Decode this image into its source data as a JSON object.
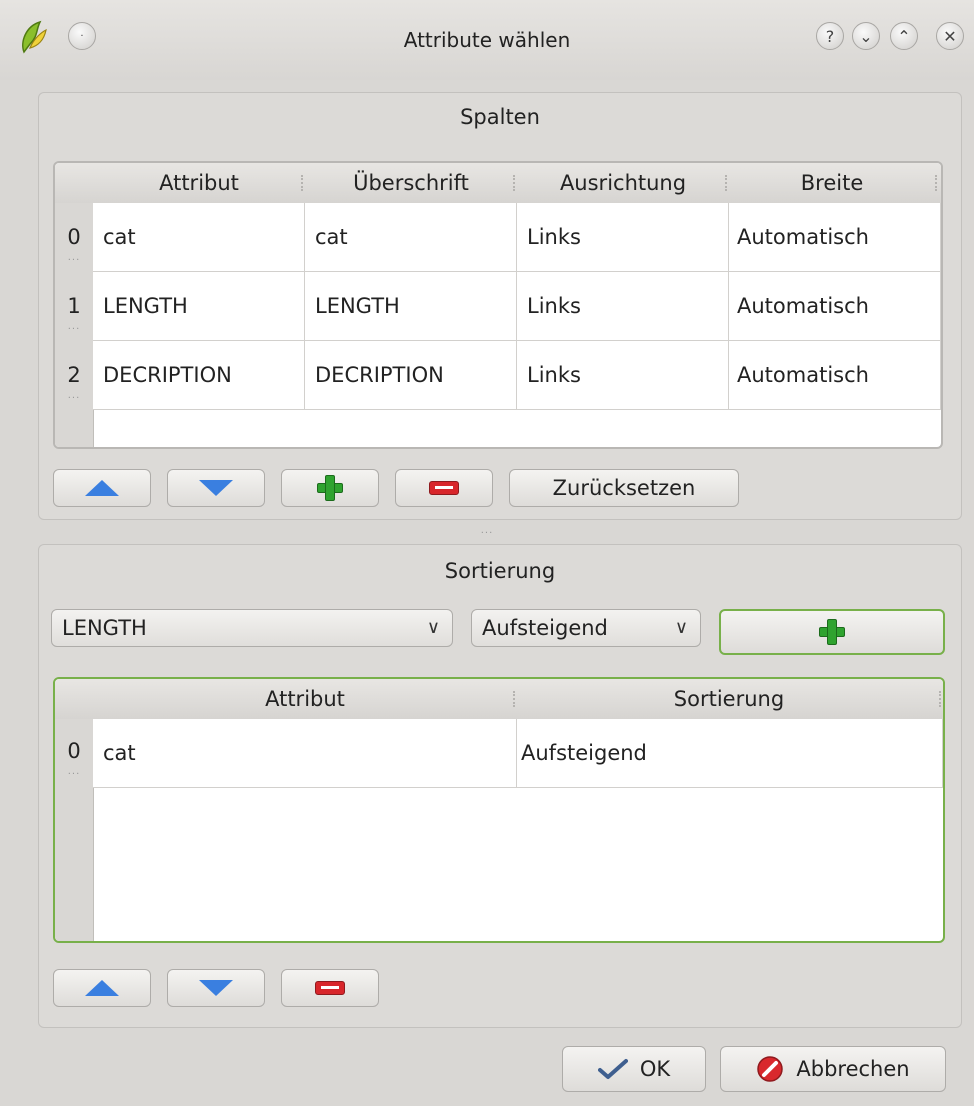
{
  "window": {
    "title": "Attribute wählen",
    "buttons": {
      "help": "?",
      "minimize": "⌄",
      "maximize": "⌃",
      "close": "✕"
    }
  },
  "columns_group": {
    "title": "Spalten",
    "headers": [
      "Attribut",
      "Überschrift",
      "Ausrichtung",
      "Breite"
    ],
    "rows": [
      {
        "index": "0",
        "attribute": "cat",
        "heading": "cat",
        "alignment": "Links",
        "width": "Automatisch"
      },
      {
        "index": "1",
        "attribute": "LENGTH",
        "heading": "LENGTH",
        "alignment": "Links",
        "width": "Automatisch"
      },
      {
        "index": "2",
        "attribute": "DECRIPTION",
        "heading": "DECRIPTION",
        "alignment": "Links",
        "width": "Automatisch"
      }
    ],
    "reset_label": "Zurücksetzen"
  },
  "sorting_group": {
    "title": "Sortierung",
    "attribute_combo": "LENGTH",
    "order_combo": "Aufsteigend",
    "headers": [
      "Attribut",
      "Sortierung"
    ],
    "rows": [
      {
        "index": "0",
        "attribute": "cat",
        "order": "Aufsteigend"
      }
    ]
  },
  "footer": {
    "ok_label": "OK",
    "cancel_label": "Abbrechen"
  },
  "colors": {
    "arrow_blue": "#3a7fe0",
    "plus_green": "#2fa32f",
    "minus_red": "#d8262b",
    "focus_border": "#78b04a"
  }
}
